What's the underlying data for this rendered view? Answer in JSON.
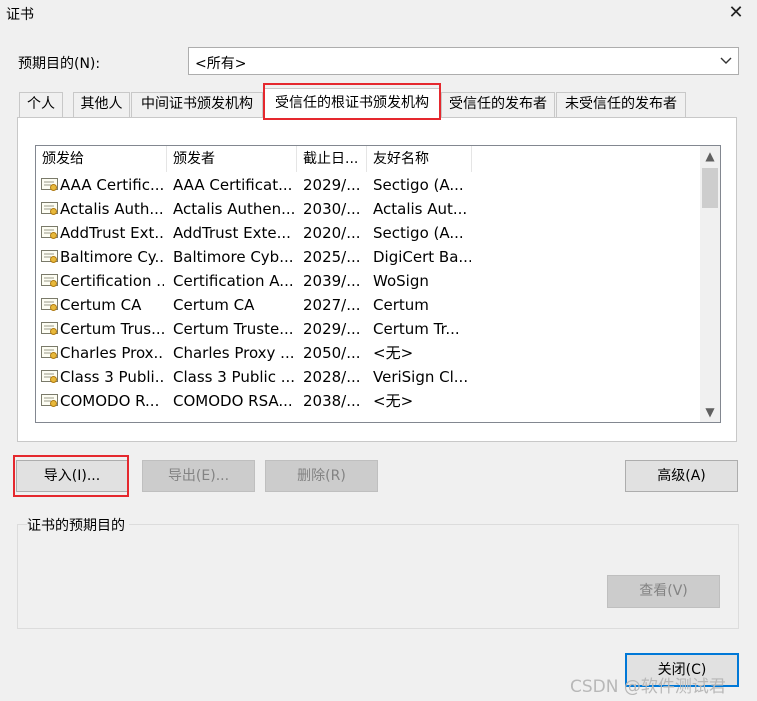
{
  "window": {
    "title": "证书"
  },
  "purpose": {
    "label": "预期目的(N):",
    "value": "<所有>"
  },
  "tabs": [
    {
      "label": "个人"
    },
    {
      "label": "其他人"
    },
    {
      "label": "中间证书颁发机构"
    },
    {
      "label": "受信任的根证书颁发机构"
    },
    {
      "label": "受信任的发布者"
    },
    {
      "label": "未受信任的发布者"
    }
  ],
  "active_tab_index": 3,
  "list": {
    "columns": [
      "颁发给",
      "颁发者",
      "截止日...",
      "友好名称"
    ],
    "rows": [
      {
        "issued_to": "AAA Certific...",
        "issued_by": "AAA Certificat...",
        "expires": "2029/...",
        "friendly": "Sectigo (A..."
      },
      {
        "issued_to": "Actalis Auth...",
        "issued_by": "Actalis Authen...",
        "expires": "2030/...",
        "friendly": "Actalis Aut..."
      },
      {
        "issued_to": "AddTrust Ext...",
        "issued_by": "AddTrust Exte...",
        "expires": "2020/...",
        "friendly": "Sectigo (A..."
      },
      {
        "issued_to": "Baltimore Cy...",
        "issued_by": "Baltimore Cyb...",
        "expires": "2025/...",
        "friendly": "DigiCert Ba..."
      },
      {
        "issued_to": "Certification ...",
        "issued_by": "Certification A...",
        "expires": "2039/...",
        "friendly": "WoSign"
      },
      {
        "issued_to": "Certum CA",
        "issued_by": "Certum CA",
        "expires": "2027/...",
        "friendly": "Certum"
      },
      {
        "issued_to": "Certum Trus...",
        "issued_by": "Certum Truste...",
        "expires": "2029/...",
        "friendly": "Certum Tr..."
      },
      {
        "issued_to": "Charles Prox...",
        "issued_by": "Charles Proxy ...",
        "expires": "2050/...",
        "friendly": "<无>"
      },
      {
        "issued_to": "Class 3 Publi...",
        "issued_by": "Class 3 Public ...",
        "expires": "2028/...",
        "friendly": "VeriSign Cl..."
      },
      {
        "issued_to": "COMODO R...",
        "issued_by": "COMODO RSA...",
        "expires": "2038/...",
        "friendly": "<无>"
      }
    ]
  },
  "buttons": {
    "import": "导入(I)...",
    "export": "导出(E)...",
    "remove": "删除(R)",
    "advanced": "高级(A)",
    "view": "查看(V)",
    "close": "关闭(C)"
  },
  "group": {
    "label": "证书的预期目的"
  },
  "watermark": "CSDN @软件测试君",
  "colors": {
    "highlight": "#e5282e",
    "default_button_border": "#0078d7"
  }
}
